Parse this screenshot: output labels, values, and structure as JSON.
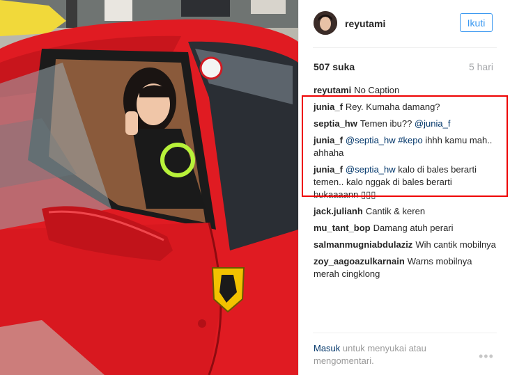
{
  "post": {
    "username": "reyutami",
    "follow_label": "Ikuti",
    "likes": "507 suka",
    "time_ago": "5 hari"
  },
  "comments": [
    {
      "user": "reyutami",
      "parts": [
        {
          "type": "text",
          "v": "No Caption"
        }
      ]
    },
    {
      "user": "junia_f",
      "parts": [
        {
          "type": "text",
          "v": "Rey. Kumaha damang?"
        }
      ]
    },
    {
      "user": "septia_hw",
      "parts": [
        {
          "type": "text",
          "v": "Temen ibu?? "
        },
        {
          "type": "mention",
          "v": "@junia_f"
        }
      ]
    },
    {
      "user": "junia_f",
      "parts": [
        {
          "type": "mention",
          "v": "@septia_hw"
        },
        {
          "type": "text",
          "v": " "
        },
        {
          "type": "mention",
          "v": "#kepo"
        },
        {
          "type": "text",
          "v": " ihhh kamu mah.. ahhaha"
        }
      ]
    },
    {
      "user": "junia_f",
      "parts": [
        {
          "type": "mention",
          "v": "@septia_hw"
        },
        {
          "type": "text",
          "v": " kalo di bales berarti temen.. kalo nggak di bales berarti bukaaaann ▯▯▯"
        }
      ]
    },
    {
      "user": "jack.julianh",
      "parts": [
        {
          "type": "text",
          "v": "Cantik & keren"
        }
      ]
    },
    {
      "user": "mu_tant_bop",
      "parts": [
        {
          "type": "text",
          "v": "Damang atuh perari"
        }
      ]
    },
    {
      "user": "salmanmugniabdulaziz",
      "parts": [
        {
          "type": "text",
          "v": "Wih cantik mobilnya"
        }
      ]
    },
    {
      "user": "zoy_aagoazulkarnain",
      "parts": [
        {
          "type": "text",
          "v": "Warns mobilnya merah cingklong"
        }
      ]
    }
  ],
  "footer": {
    "login_link": "Masuk",
    "rest": " untuk menyukai atau mengomentari.",
    "more": "•••"
  },
  "colors": {
    "car_red": "#e01b22",
    "link_blue": "#3897f0",
    "mention_blue": "#003569",
    "highlight_red": "#e00000"
  }
}
